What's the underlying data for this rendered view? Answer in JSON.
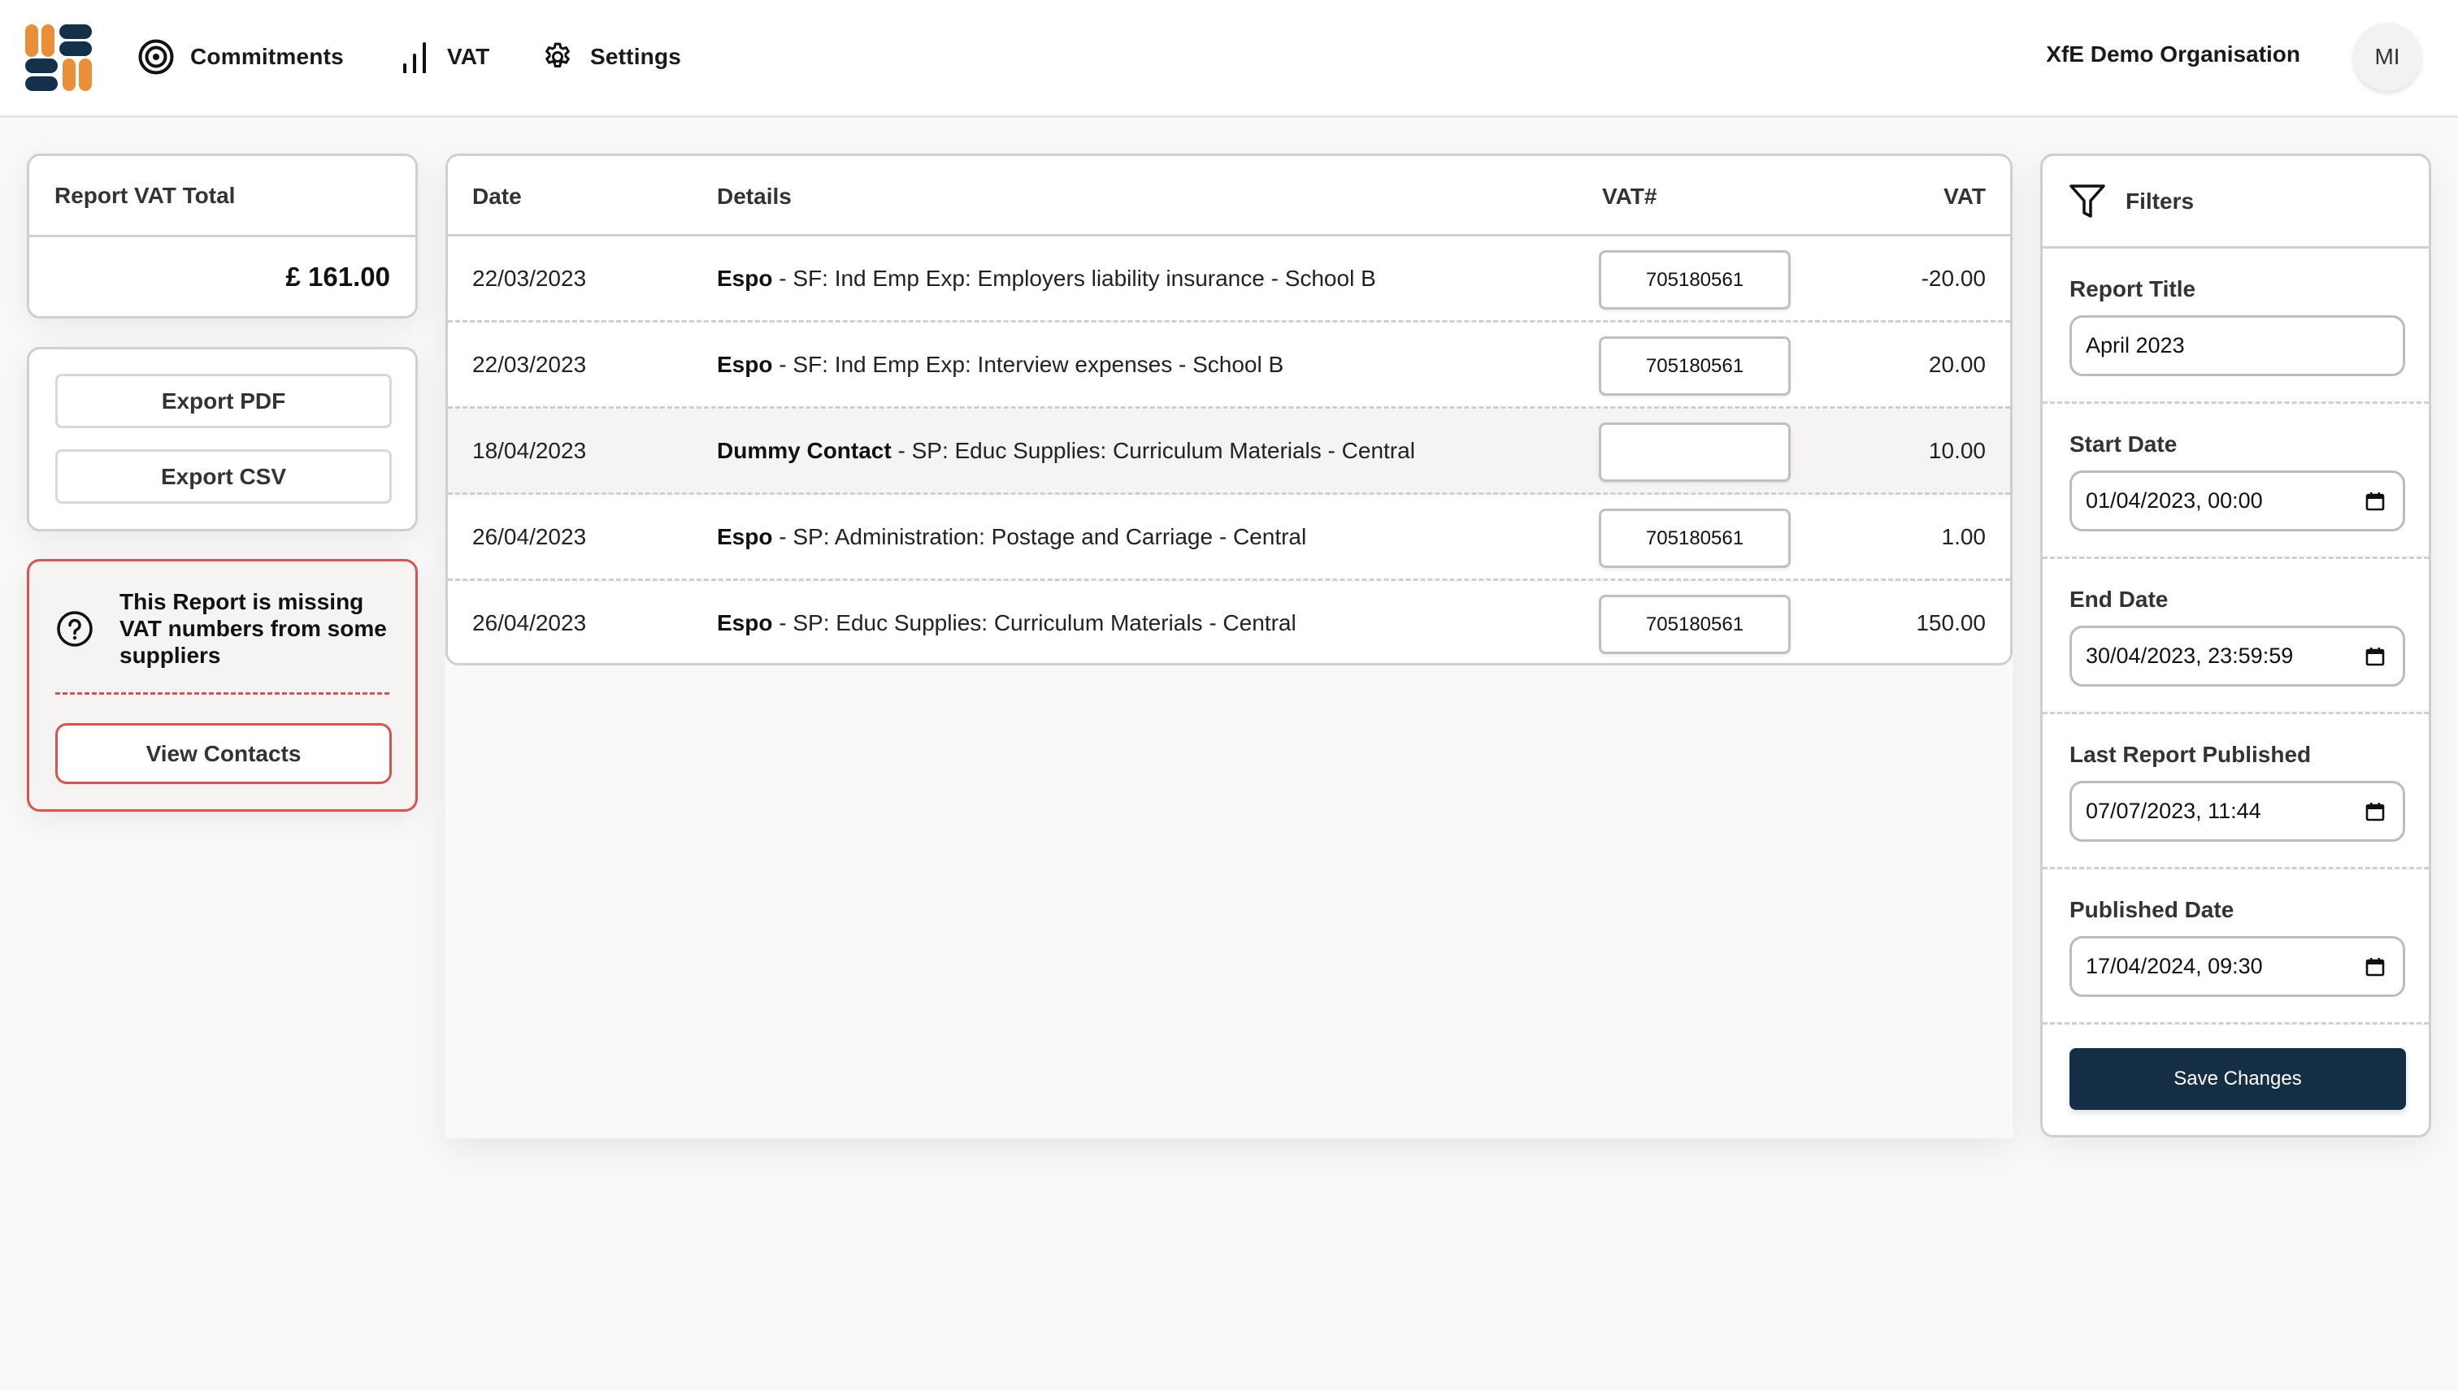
{
  "brand": {
    "logo_colors": {
      "orange": "#ea8e38",
      "navy": "#14304a"
    }
  },
  "nav": {
    "items": [
      {
        "label": "Commitments",
        "icon": "target-icon"
      },
      {
        "label": "VAT",
        "icon": "bar-chart-icon"
      },
      {
        "label": "Settings",
        "icon": "gear-icon"
      }
    ],
    "organisation": "XfE Demo Organisation",
    "avatar_initials": "MI"
  },
  "summary": {
    "title": "Report VAT Total",
    "total": "£ 161.00"
  },
  "exports": {
    "pdf_label": "Export PDF",
    "csv_label": "Export CSV"
  },
  "alert": {
    "icon": "question-circle-icon",
    "message": "This Report is missing VAT numbers from some suppliers",
    "button_label": "View Contacts",
    "color": "#d9534f"
  },
  "table": {
    "columns": [
      "Date",
      "Details",
      "VAT#",
      "VAT"
    ],
    "rows": [
      {
        "date": "22/03/2023",
        "contact": "Espo",
        "description": " - SF: Ind Emp Exp: Employers liability insurance - School B",
        "vat_number": "705180561",
        "vat": "-20.00",
        "missing": false
      },
      {
        "date": "22/03/2023",
        "contact": "Espo",
        "description": " - SF: Ind Emp Exp: Interview expenses - School B",
        "vat_number": "705180561",
        "vat": "20.00",
        "missing": false
      },
      {
        "date": "18/04/2023",
        "contact": "Dummy Contact",
        "description": " - SP: Educ Supplies: Curriculum Materials - Central",
        "vat_number": "",
        "vat": "10.00",
        "missing": true
      },
      {
        "date": "26/04/2023",
        "contact": "Espo",
        "description": " - SP: Administration: Postage and Carriage - Central",
        "vat_number": "705180561",
        "vat": "1.00",
        "missing": false
      },
      {
        "date": "26/04/2023",
        "contact": "Espo",
        "description": " - SP: Educ Supplies: Curriculum Materials - Central",
        "vat_number": "705180561",
        "vat": "150.00",
        "missing": false
      }
    ]
  },
  "filters": {
    "title": "Filters",
    "fields": [
      {
        "label": "Report Title",
        "value": "April 2023",
        "type": "text"
      },
      {
        "label": "Start Date",
        "value": "01/04/2023, 00:00",
        "type": "datetime"
      },
      {
        "label": "End Date",
        "value": "30/04/2023, 23:59:59",
        "type": "datetime"
      },
      {
        "label": "Last Report Published",
        "value": "07/07/2023, 11:44",
        "type": "datetime"
      },
      {
        "label": "Published Date",
        "value": "17/04/2024, 09:30",
        "type": "datetime"
      }
    ],
    "save_label": "Save Changes",
    "save_color": "#142f45"
  }
}
